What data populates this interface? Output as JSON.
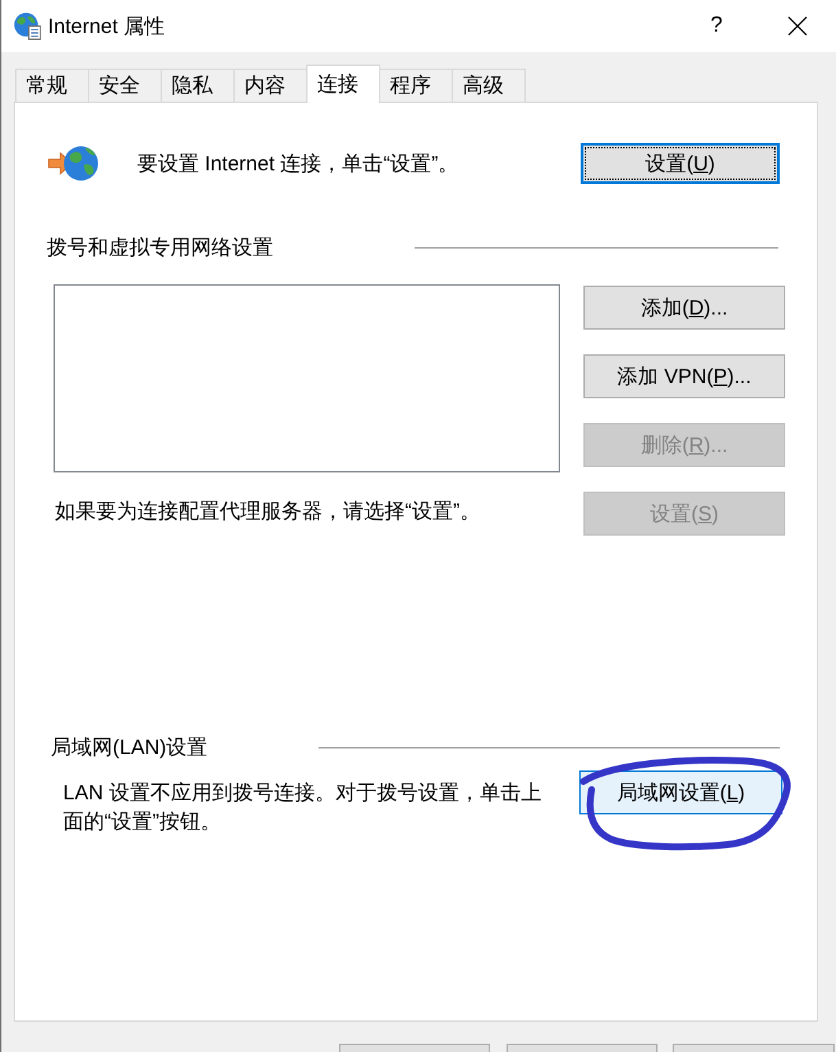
{
  "window": {
    "title": "Internet 属性",
    "help_button": "?"
  },
  "tabs": [
    {
      "label": "常规",
      "selected": false
    },
    {
      "label": "安全",
      "selected": false
    },
    {
      "label": "隐私",
      "selected": false
    },
    {
      "label": "内容",
      "selected": false
    },
    {
      "label": "连接",
      "selected": true
    },
    {
      "label": "程序",
      "selected": false
    },
    {
      "label": "高级",
      "selected": false
    }
  ],
  "connection_setup": {
    "text": "要设置 Internet 连接，单击“设置”。",
    "button": {
      "before": "设置(",
      "key": "U",
      "after": ")",
      "focused": true,
      "disabled": false
    }
  },
  "dialup_vpn": {
    "heading": "拨号和虚拟专用网络设置",
    "buttons": [
      {
        "before": "添加(",
        "key": "D",
        "after": ")...",
        "disabled": false
      },
      {
        "before": "添加 VPN(",
        "key": "P",
        "after": ")...",
        "disabled": false
      },
      {
        "before": "删除(",
        "key": "R",
        "after": ")...",
        "disabled": true
      },
      {
        "before": "设置(",
        "key": "S",
        "after": ")",
        "disabled": true
      }
    ],
    "proxy_note": "如果要为连接配置代理服务器，请选择“设置”。"
  },
  "lan": {
    "heading": "局域网(LAN)设置",
    "note": "LAN 设置不应用到拨号连接。对于拨号设置，单击上面的“设置”按钮。",
    "button": {
      "before": "局域网设置(",
      "key": "L",
      "after": ")",
      "hovered": true,
      "disabled": false
    }
  }
}
